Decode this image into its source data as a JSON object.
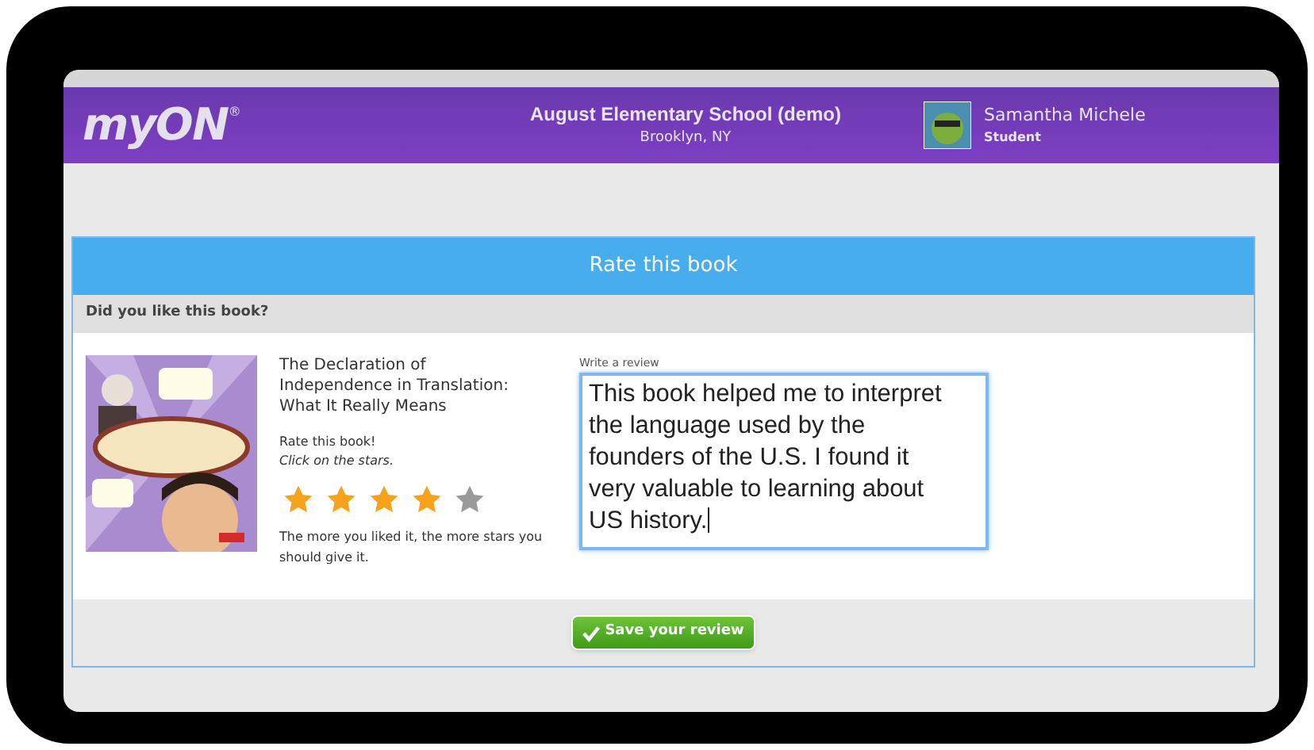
{
  "header": {
    "logo": "myON",
    "logo_mark": "®",
    "school": "August Elementary School (demo)",
    "location": "Brooklyn, NY",
    "user": {
      "name": "Samantha Michele",
      "role": "Student"
    }
  },
  "panel": {
    "title": "Rate this book",
    "question": "Did you like this book?",
    "book": {
      "title": "The Declaration of Independence in Translation: What It Really Means"
    },
    "rate_label": "Rate this book!",
    "rate_hint": "Click on the stars.",
    "stars": 4,
    "rate_note": "The more you liked it, the more stars you should give it.",
    "review": {
      "label": "Write a review",
      "value": "This book helped me to interpret the language used by the founders of the U.S. I found it very valuable to learning about US history.",
      "focused": true
    },
    "save_button": "Save your review"
  }
}
